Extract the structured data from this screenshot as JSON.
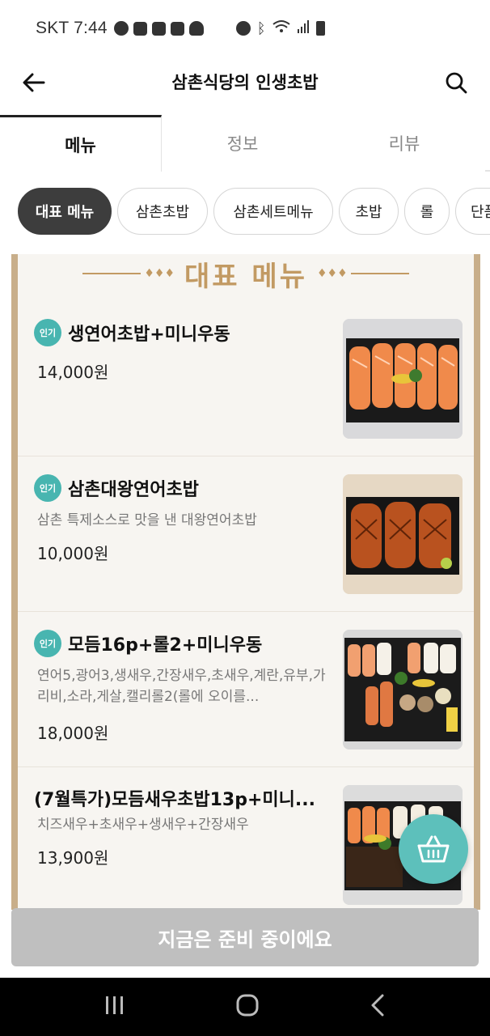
{
  "status_bar": {
    "carrier_time": "SKT 7:44"
  },
  "header": {
    "title": "삼촌식당의 인생초밥"
  },
  "tabs": [
    {
      "label": "메뉴",
      "active": true
    },
    {
      "label": "정보",
      "active": false
    },
    {
      "label": "리뷰",
      "active": false
    }
  ],
  "chips": [
    {
      "label": "대표 메뉴",
      "active": true
    },
    {
      "label": "삼촌초밥"
    },
    {
      "label": "삼촌세트메뉴"
    },
    {
      "label": "초밥"
    },
    {
      "label": "롤"
    },
    {
      "label": "단품"
    }
  ],
  "board": {
    "title": "대표 메뉴"
  },
  "items": [
    {
      "badge": "인기",
      "name": "생연어초밥+미니우동",
      "desc": "",
      "price": "14,000원"
    },
    {
      "badge": "인기",
      "name": "삼촌대왕연어초밥",
      "desc": "삼촌 특제소스로 맛을 낸 대왕연어초밥",
      "price": "10,000원"
    },
    {
      "badge": "인기",
      "name": "모듬16p+롤2+미니우동",
      "desc": "연어5,광어3,생새우,간장새우,초새우,계란,유부,가리비,소라,게살,캘리롤2(롤에 오이를...",
      "price": "18,000원"
    },
    {
      "badge": "",
      "name": "(7월특가)모듬새우초밥13p+미니...",
      "desc": "치즈새우+초새우+생새우+간장새우",
      "price": "13,900원"
    }
  ],
  "bottom_button": {
    "label": "지금은 준비 중이에요"
  },
  "colors": {
    "accent": "#5dc0bb",
    "badge": "#48b5b0",
    "gold": "#c29a63",
    "disabled": "#bfbfbf"
  }
}
